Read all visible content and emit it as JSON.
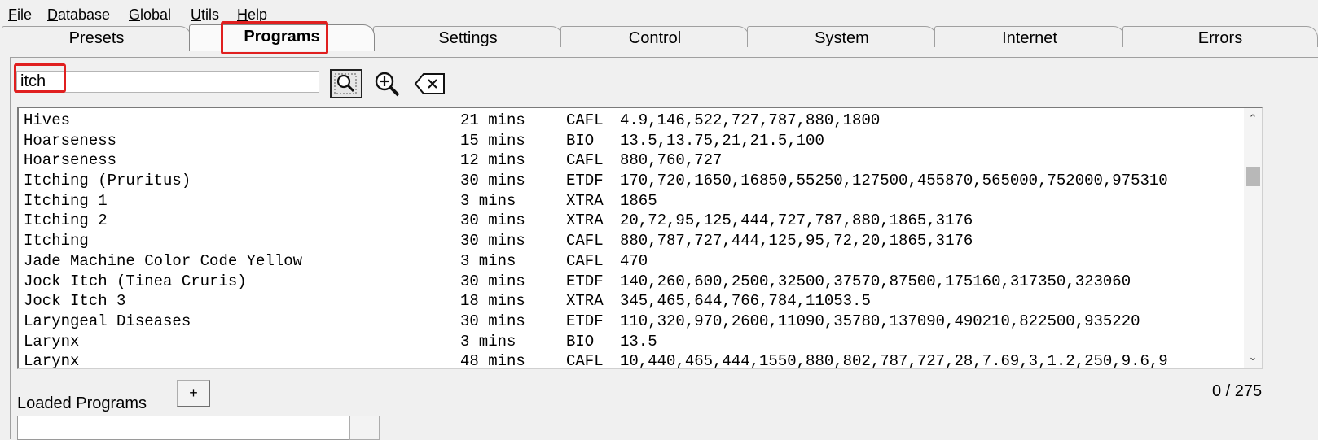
{
  "menu": [
    "File",
    "Database",
    "Global",
    "Utils",
    "Help"
  ],
  "tabs": [
    "Presets",
    "Programs",
    "Settings",
    "Control",
    "System",
    "Internet",
    "Errors"
  ],
  "active_tab": "Programs",
  "search": {
    "value": "itch"
  },
  "program_list": [
    {
      "name": "Hives",
      "duration": "21 mins",
      "type": "CAFL",
      "frequencies": "4.9,146,522,727,787,880,1800"
    },
    {
      "name": "Hoarseness",
      "duration": "15 mins",
      "type": "BIO",
      "frequencies": "13.5,13.75,21,21.5,100"
    },
    {
      "name": "Hoarseness",
      "duration": "12 mins",
      "type": "CAFL",
      "frequencies": "880,760,727"
    },
    {
      "name": "Itching (Pruritus)",
      "duration": "30 mins",
      "type": "ETDF",
      "frequencies": "170,720,1650,16850,55250,127500,455870,565000,752000,975310"
    },
    {
      "name": "Itching 1",
      "duration": "3 mins",
      "type": "XTRA",
      "frequencies": "1865"
    },
    {
      "name": "Itching 2",
      "duration": "30 mins",
      "type": "XTRA",
      "frequencies": "20,72,95,125,444,727,787,880,1865,3176"
    },
    {
      "name": "Itching",
      "duration": "30 mins",
      "type": "CAFL",
      "frequencies": "880,787,727,444,125,95,72,20,1865,3176"
    },
    {
      "name": "Jade Machine Color Code Yellow",
      "duration": "3 mins",
      "type": "CAFL",
      "frequencies": "470"
    },
    {
      "name": "Jock Itch (Tinea Cruris)",
      "duration": "30 mins",
      "type": "ETDF",
      "frequencies": "140,260,600,2500,32500,37570,87500,175160,317350,323060"
    },
    {
      "name": "Jock Itch 3",
      "duration": "18 mins",
      "type": "XTRA",
      "frequencies": "345,465,644,766,784,11053.5"
    },
    {
      "name": "Laryngeal Diseases",
      "duration": "30 mins",
      "type": "ETDF",
      "frequencies": "110,320,970,2600,11090,35780,137090,490210,822500,935220"
    },
    {
      "name": "Larynx",
      "duration": "3 mins",
      "type": "BIO",
      "frequencies": "13.5"
    },
    {
      "name": "Larynx",
      "duration": "48 mins",
      "type": "CAFL",
      "frequencies": "10,440,465,444,1550,880,802,787,727,28,7.69,3,1.2,250,9.6,9"
    }
  ],
  "count": "0 / 275",
  "add_button": "+",
  "loaded_programs_label": "Loaded Programs",
  "colors": {
    "highlight": "#e01f1f",
    "background": "#f0f0f0"
  },
  "icons": {
    "search_button": "search-icon",
    "zoom_button": "zoom-in-icon",
    "clear_button": "backspace-clear-icon"
  }
}
